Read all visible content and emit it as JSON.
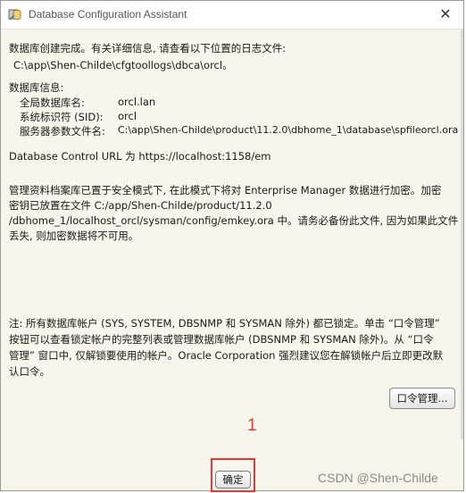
{
  "window": {
    "title": "Database Configuration Assistant",
    "close_symbol": "✕"
  },
  "content": {
    "completion_line": "数据库创建完成。有关详细信息, 请查看以下位置的日志文件:",
    "log_path": "C:\\app\\Shen-Childe\\cfgtoollogs\\dbca\\orcl。",
    "db_info_heading": "数据库信息:",
    "db_info": [
      {
        "label": "全局数据库名:",
        "value": "orcl.lan"
      },
      {
        "label": "系统标识符 (SID):",
        "value": "orcl"
      },
      {
        "label": "服务器参数文件名:",
        "value": "C:\\app\\Shen-Childe\\product\\11.2.0\\dbhome_1\\database\\spfileorcl.ora"
      }
    ],
    "em_url_line": "Database Control URL 为 https://localhost:1158/em",
    "repository_lines": [
      "管理资料档案库已置于安全模式下, 在此模式下将对 Enterprise Manager 数据进行加密。加密",
      "密钥已放置在文件 C:/app/Shen-Childe/product/11.2.0",
      "/dbhome_1/localhost_orcl/sysman/config/emkey.ora 中。请务必备份此文件, 因为如果此文件",
      "丢失, 则加密数据将不可用。"
    ],
    "note_lines": [
      "注: 所有数据库帐户 (SYS, SYSTEM, DBSNMP 和 SYSMAN 除外) 都已锁定。单击 “口令管理”",
      "按钮可以查看锁定帐户的完整列表或管理数据库帐户 (DBSNMP 和 SYSMAN 除外)。从 “口令",
      "管理” 窗口中, 仅解锁要使用的帐户。Oracle Corporation 强烈建议您在解锁帐户后立即更改默",
      "认口令。"
    ]
  },
  "buttons": {
    "password_management": "口令管理...",
    "ok": "确定"
  },
  "annotation": {
    "step_number": "1",
    "highlight_color": "#e53935"
  },
  "watermark": "CSDN @Shen-Childe",
  "colors": {
    "dialog_background": "#f6f6ec",
    "title_background": "#ffffff"
  }
}
